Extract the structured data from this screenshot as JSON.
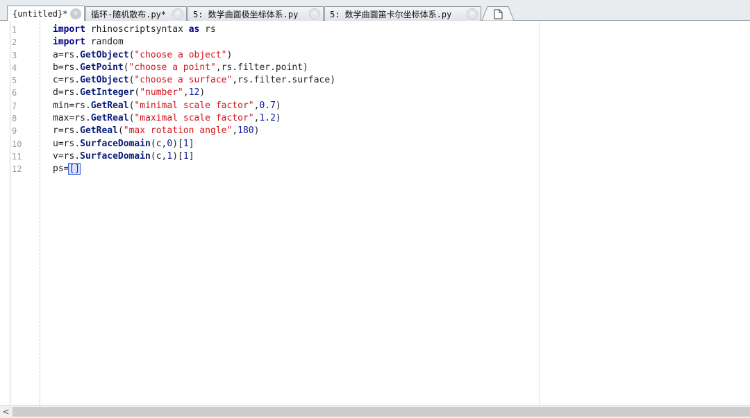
{
  "tabs": [
    {
      "label": "{untitled}*",
      "active": true
    },
    {
      "label": "循环-随机散布.py*",
      "active": false
    },
    {
      "label": "5: 数学曲面极坐标体系.py",
      "active": false
    },
    {
      "label": "5: 数学曲面笛卡尔坐标体系.py",
      "active": false
    }
  ],
  "icons": {
    "tab_close": "close-icon",
    "new_tab": "new-document-icon",
    "scroll_left": "chevron-left-icon"
  },
  "editor": {
    "line_numbers": [
      "1",
      "2",
      "3",
      "4",
      "5",
      "6",
      "7",
      "8",
      "9",
      "10",
      "11",
      "12"
    ],
    "lines": [
      [
        {
          "t": "kw",
          "v": "import"
        },
        {
          "t": "pl",
          "v": " rhinoscriptsyntax "
        },
        {
          "t": "kw",
          "v": "as"
        },
        {
          "t": "pl",
          "v": " rs"
        }
      ],
      [
        {
          "t": "kw",
          "v": "import"
        },
        {
          "t": "pl",
          "v": " random"
        }
      ],
      [
        {
          "t": "pl",
          "v": "a=rs."
        },
        {
          "t": "fn",
          "v": "GetObject"
        },
        {
          "t": "pl",
          "v": "("
        },
        {
          "t": "str",
          "v": "\"choose a object\""
        },
        {
          "t": "pl",
          "v": ")"
        }
      ],
      [
        {
          "t": "pl",
          "v": "b=rs."
        },
        {
          "t": "fn",
          "v": "GetPoint"
        },
        {
          "t": "pl",
          "v": "("
        },
        {
          "t": "str",
          "v": "\"choose a point\""
        },
        {
          "t": "pl",
          "v": ",rs.filter.point)"
        }
      ],
      [
        {
          "t": "pl",
          "v": "c=rs."
        },
        {
          "t": "fn",
          "v": "GetObject"
        },
        {
          "t": "pl",
          "v": "("
        },
        {
          "t": "str",
          "v": "\"choose a surface\""
        },
        {
          "t": "pl",
          "v": ",rs.filter.surface)"
        }
      ],
      [
        {
          "t": "pl",
          "v": "d=rs."
        },
        {
          "t": "fn",
          "v": "GetInteger"
        },
        {
          "t": "pl",
          "v": "("
        },
        {
          "t": "str",
          "v": "\"number\""
        },
        {
          "t": "pl",
          "v": ","
        },
        {
          "t": "num",
          "v": "12"
        },
        {
          "t": "pl",
          "v": ")"
        }
      ],
      [
        {
          "t": "pl",
          "v": "min=rs."
        },
        {
          "t": "fn",
          "v": "GetReal"
        },
        {
          "t": "pl",
          "v": "("
        },
        {
          "t": "str",
          "v": "\"minimal scale factor\""
        },
        {
          "t": "pl",
          "v": ","
        },
        {
          "t": "num",
          "v": "0.7"
        },
        {
          "t": "pl",
          "v": ")"
        }
      ],
      [
        {
          "t": "pl",
          "v": "max=rs."
        },
        {
          "t": "fn",
          "v": "GetReal"
        },
        {
          "t": "pl",
          "v": "("
        },
        {
          "t": "str",
          "v": "\"maximal scale factor\""
        },
        {
          "t": "pl",
          "v": ","
        },
        {
          "t": "num",
          "v": "1.2"
        },
        {
          "t": "pl",
          "v": ")"
        }
      ],
      [
        {
          "t": "pl",
          "v": "r=rs."
        },
        {
          "t": "fn",
          "v": "GetReal"
        },
        {
          "t": "pl",
          "v": "("
        },
        {
          "t": "str",
          "v": "\"max rotation angle\""
        },
        {
          "t": "pl",
          "v": ","
        },
        {
          "t": "num",
          "v": "180"
        },
        {
          "t": "pl",
          "v": ")"
        }
      ],
      [
        {
          "t": "pl",
          "v": "u=rs."
        },
        {
          "t": "fn",
          "v": "SurfaceDomain"
        },
        {
          "t": "pl",
          "v": "(c,"
        },
        {
          "t": "num",
          "v": "0"
        },
        {
          "t": "pl",
          "v": ")["
        },
        {
          "t": "num",
          "v": "1"
        },
        {
          "t": "pl",
          "v": "]"
        }
      ],
      [
        {
          "t": "pl",
          "v": "v=rs."
        },
        {
          "t": "fn",
          "v": "SurfaceDomain"
        },
        {
          "t": "pl",
          "v": "(c,"
        },
        {
          "t": "num",
          "v": "1"
        },
        {
          "t": "pl",
          "v": ")["
        },
        {
          "t": "num",
          "v": "1"
        },
        {
          "t": "pl",
          "v": "]"
        }
      ],
      [
        {
          "t": "pl",
          "v": "ps="
        },
        {
          "t": "brace",
          "v": "[]"
        }
      ]
    ]
  },
  "colors": {
    "keyword": "#00008b",
    "function": "#0a1e7a",
    "string": "#d1141b",
    "number": "#0d1a9e",
    "brace_highlight": "#3a5fd8"
  }
}
